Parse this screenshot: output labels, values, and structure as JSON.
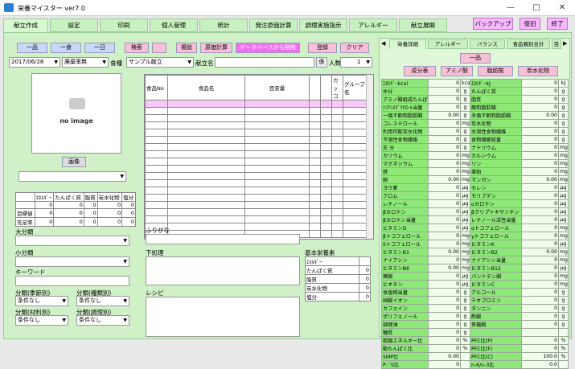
{
  "window": {
    "title": "栄養マイスター ver7.0",
    "min": "—",
    "max": "□",
    "close": "✕"
  },
  "tabs": [
    "献立作成",
    "設定",
    "印刷",
    "個人管理",
    "統計",
    "発注原価計算",
    "調理実施指示",
    "アレルギー",
    "献立展開"
  ],
  "top_buttons": [
    "バックアップ",
    "復旧",
    "終了"
  ],
  "toolbar": {
    "b1": "一品",
    "b2": "一食",
    "b3": "一日",
    "b4": "検索",
    "b5": "",
    "b6": "複絵",
    "b7": "原価計算",
    "b8": "データベースから削除",
    "b9": "登録",
    "b10": "クリア"
  },
  "form": {
    "date": "2017/06/28",
    "waste": "廃棄率無",
    "meal_label": "食種",
    "meal": "サンプル献立",
    "menu_label": "献立名",
    "menu": "",
    "kakari": "係",
    "ninzu_label": "人数",
    "ninzu": "1"
  },
  "image": {
    "no_image": "no image",
    "button": "画像"
  },
  "summary": {
    "headers": [
      "",
      "ｴﾈﾙｷﾞｰ",
      "たんぱく質",
      "脂質",
      "炭水化物",
      "塩分"
    ],
    "rows": [
      [
        "",
        "0",
        "0",
        "0",
        "0",
        "0"
      ],
      [
        "目標値",
        "0",
        "0",
        "0",
        "0",
        "0"
      ],
      [
        "充足率",
        "0",
        "0",
        "0",
        "0",
        "0"
      ]
    ]
  },
  "food_table": {
    "headers": [
      "食品No",
      "食品名",
      "目安量",
      "",
      "",
      "カッコ",
      "グループ名"
    ]
  },
  "left_labels": {
    "daibunrui": "大分類",
    "shobunrui": "小分類",
    "keyword": "キーワード",
    "kisetsu": "分類(季節別)",
    "shurui": "分類(種類別)",
    "zairyo": "分類(材料別)",
    "chori": "分類(調理別)",
    "none": "条件なし"
  },
  "furigana": "ふりがな",
  "shita": "下処理",
  "recipe": "レシピ",
  "basic": {
    "title": "基本栄養素",
    "rows": [
      [
        "ｴﾈﾙｷﾞｰ",
        ""
      ],
      [
        "たんぱく質",
        "0"
      ],
      [
        "脂質",
        "0"
      ],
      [
        "炭水化物",
        "0"
      ],
      [
        "塩分",
        "0"
      ]
    ]
  },
  "right_tabs": [
    "栄養詳細",
    "アレルギー",
    "バランス",
    "食品類別合計",
    "目"
  ],
  "right_btns": {
    "ippin": "一品",
    "seibun": "成分表",
    "amino": "アミノ酸",
    "shibo": "脂肪酸",
    "tansui": "炭水化物"
  },
  "nutrients": [
    [
      "ｴﾈﾙｷﾞｰkcal",
      "0",
      "kcal",
      "ｴﾈﾙｷﾞｰkJ",
      "0",
      "kJ"
    ],
    [
      "水分",
      "0",
      "g",
      "たんぱく質",
      "0",
      "g"
    ],
    [
      "アミノ酸組成たんぱく",
      "0",
      "g",
      "脂質",
      "0",
      "g"
    ],
    [
      "ﾄﾘｱｼﾙｸﾞﾘｾﾛｰﾙ当量",
      "0",
      "g",
      "飽和脂肪酸",
      "0",
      "g"
    ],
    [
      "一価不飽和脂肪酸",
      "0.00",
      "g",
      "多価不飽和脂肪酸",
      "0.00",
      "g"
    ],
    [
      "コレステロール",
      "0",
      "mg",
      "炭水化物",
      "0",
      "g"
    ],
    [
      "利用可能炭水化物",
      "0",
      "g",
      "水溶性食物繊維",
      "0",
      "g"
    ],
    [
      "不溶性食物繊維",
      "0",
      "g",
      "食物繊維総量",
      "0",
      "g"
    ],
    [
      "灰 分",
      "0",
      "g",
      "ナトリウム",
      "0",
      "mg"
    ],
    [
      "カリウム",
      "0",
      "mg",
      "カルシウム",
      "0",
      "mg"
    ],
    [
      "マグネシウム",
      "0",
      "mg",
      "リン",
      "0",
      "mg"
    ],
    [
      "鉄",
      "0",
      "mg",
      "亜鉛",
      "0",
      "mg"
    ],
    [
      "銅",
      "0.00",
      "mg",
      "マンガン",
      "0.00",
      "mg"
    ],
    [
      "ヨウ素",
      "0",
      "μg",
      "セレン",
      "0",
      "μg"
    ],
    [
      "クロム",
      "0",
      "μg",
      "モリブデン",
      "0",
      "μg"
    ],
    [
      "レチノール",
      "0",
      "μg",
      "αカロテン",
      "0",
      "μg"
    ],
    [
      "βカロテン",
      "0",
      "μg",
      "βクリプトキサンチン",
      "0",
      "μg"
    ],
    [
      "βカロテン当量",
      "0",
      "μg",
      "レチノール活性当量",
      "0",
      "μg"
    ],
    [
      "ビタミンD",
      "0",
      "μg",
      "αトコフェロール",
      "0",
      "mg"
    ],
    [
      "βトコフェロール",
      "0",
      "mg",
      "γトコフェロール",
      "0",
      "mg"
    ],
    [
      "δトコフェロール",
      "0",
      "mg",
      "ビタミンK",
      "0",
      "μg"
    ],
    [
      "ビタミンB1",
      "0.00",
      "mg",
      "ビタミンB2",
      "0.00",
      "mg"
    ],
    [
      "ナイアシン",
      "0",
      "mg",
      "ナイアシン当量",
      "0",
      "mg"
    ],
    [
      "ビタミンB6",
      "0.00",
      "mg",
      "ビタミンB12",
      "0",
      "μg"
    ],
    [
      "葉酸",
      "0",
      "μg",
      "パントテン酸",
      "0",
      "mg"
    ],
    [
      "ビオチン",
      "0",
      "μg",
      "ビタミンC",
      "0",
      "mg"
    ],
    [
      "食塩相当量",
      "0",
      "g",
      "アルコール",
      "0",
      "g"
    ],
    [
      "硝酸イオン",
      "0",
      "g",
      "テオブロミン",
      "0",
      "g"
    ],
    [
      "カフェイン",
      "0",
      "g",
      "タンニン",
      "0",
      "g"
    ],
    [
      "ポリフェノール",
      "0",
      "g",
      "酢酸",
      "0",
      "g"
    ],
    [
      "調理油",
      "0",
      "g",
      "有機酸",
      "0",
      "g"
    ],
    [
      "糖質",
      "0",
      "g",
      "",
      "",
      ""
    ],
    [
      "穀類エネルギー比",
      "0",
      "%",
      "PFC比(P)",
      "0",
      "%"
    ],
    [
      "動たんぱく比",
      "0",
      "%",
      "PFC比(F)",
      "0",
      "%"
    ],
    [
      "SMP比",
      "0.00",
      "",
      "PFC比(C)",
      "100.0",
      "%"
    ],
    [
      "P／S比",
      "0",
      "",
      "n-6/n-3比",
      "0.0",
      ""
    ]
  ]
}
